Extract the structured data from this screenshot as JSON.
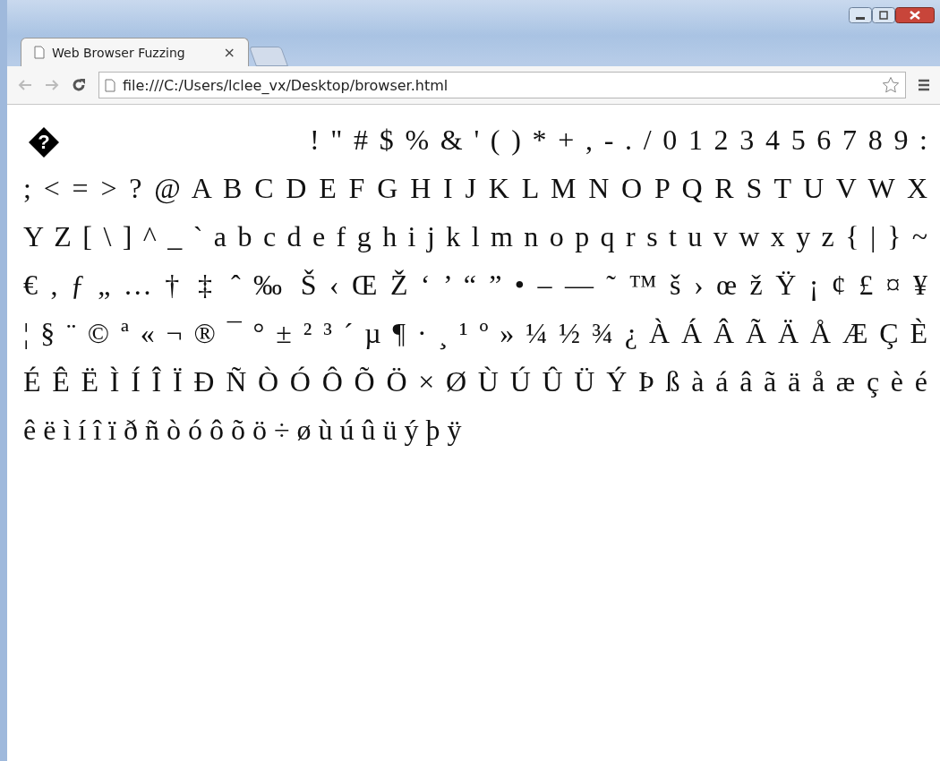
{
  "tab": {
    "title": "Web Browser Fuzzing",
    "close": "×"
  },
  "address_bar": {
    "url": "file:///C:/Users/lclee_vx/Desktop/browser.html"
  },
  "page": {
    "lines": [
      {
        "lead": "?",
        "text": "! \" # $ % & ' ( ) * + , - . / 0 1 2 3 4 5 6 7 8 9 :"
      },
      {
        "text": "; < = > ? @ A B C D E F G H I J K L M N O P Q R S T U V W X"
      },
      {
        "text": "Y Z [ \\ ] ^ _ ` a b c d e f g h i j k l m n o p q r s t u v w x y z { | } ~"
      },
      {
        "text": "€ , ƒ „ … † ‡ ˆ ‰ Š ‹ Œ Ž ‘ ’ “ ” • – — ˜ ™ š › œ ž Ÿ ¡ ¢ £ ¤ ¥"
      },
      {
        "text": "¦ § ¨ © ª « ¬ ® ¯ ° ± ² ³ ´ µ ¶ · ¸ ¹ º » ¼ ½ ¾ ¿ À Á Â Ã Ä Å Æ Ç È"
      },
      {
        "text": "É Ê Ë Ì Í Î Ï Ð Ñ Ò Ó Ô Õ Ö × Ø Ù Ú Û Ü Ý Þ ß à á â ã ä å æ ç è é"
      },
      {
        "text": "ê ë ì í î ï ð ñ ò ó ô õ ö ÷ ø ù ú û ü ý þ ÿ"
      }
    ]
  }
}
